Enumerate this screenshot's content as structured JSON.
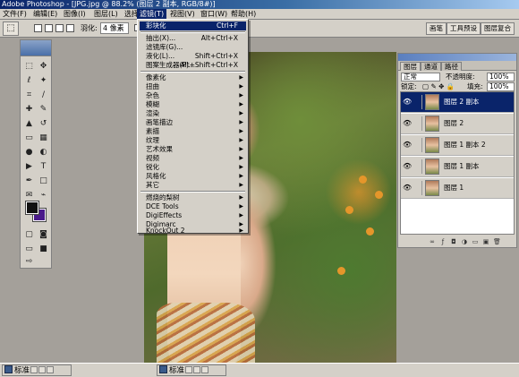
{
  "window": {
    "title": "Adobe Photoshop - [JPG.jpg @ 88.2% (图层 2 副本, RGB/8#)]"
  },
  "menubar": [
    {
      "label": "文件(F)"
    },
    {
      "label": "编辑(E)"
    },
    {
      "label": "图像(I)"
    },
    {
      "label": "图层(L)"
    },
    {
      "label": "选择(S)"
    },
    {
      "label": "滤镜(T)"
    },
    {
      "label": "视图(V)"
    },
    {
      "label": "窗口(W)"
    },
    {
      "label": "帮助(H)"
    }
  ],
  "options": {
    "feather_label": "羽化:",
    "feather_value": "4 像素",
    "antialias_label": "消除锯齿"
  },
  "palette_well": [
    "画笔",
    "工具预设",
    "图层复合"
  ],
  "filter_menu": {
    "items": [
      {
        "label": "彩块化",
        "shortcut": "Ctrl+F",
        "submenu": false,
        "highlighted": true
      },
      {
        "label": "抽出(X)...",
        "shortcut": "Alt+Ctrl+X",
        "submenu": false
      },
      {
        "label": "滤镜库(G)...",
        "shortcut": "",
        "submenu": false
      },
      {
        "label": "液化(L)...",
        "shortcut": "Shift+Ctrl+X",
        "submenu": false
      },
      {
        "label": "图案生成器(P)...",
        "shortcut": "Alt+Shift+Ctrl+X",
        "submenu": false
      },
      {
        "label": "像素化",
        "shortcut": "",
        "submenu": true
      },
      {
        "label": "扭曲",
        "shortcut": "",
        "submenu": true
      },
      {
        "label": "杂色",
        "shortcut": "",
        "submenu": true
      },
      {
        "label": "模糊",
        "shortcut": "",
        "submenu": true
      },
      {
        "label": "渲染",
        "shortcut": "",
        "submenu": true
      },
      {
        "label": "画笔描边",
        "shortcut": "",
        "submenu": true
      },
      {
        "label": "素描",
        "shortcut": "",
        "submenu": true
      },
      {
        "label": "纹理",
        "shortcut": "",
        "submenu": true
      },
      {
        "label": "艺术效果",
        "shortcut": "",
        "submenu": true
      },
      {
        "label": "视频",
        "shortcut": "",
        "submenu": true
      },
      {
        "label": "锐化",
        "shortcut": "",
        "submenu": true
      },
      {
        "label": "风格化",
        "shortcut": "",
        "submenu": true
      },
      {
        "label": "其它",
        "shortcut": "",
        "submenu": true
      },
      {
        "label": "燃烧的梨树",
        "shortcut": "",
        "submenu": true
      },
      {
        "label": "DCE Tools",
        "shortcut": "",
        "submenu": true
      },
      {
        "label": "DigiEffects",
        "shortcut": "",
        "submenu": true
      },
      {
        "label": "Digimarc",
        "shortcut": "",
        "submenu": true
      },
      {
        "label": "KnockOut 2",
        "shortcut": "",
        "submenu": true
      }
    ]
  },
  "layers_panel": {
    "tabs": [
      "图层",
      "通道",
      "路径"
    ],
    "blend_mode": "正常",
    "opacity_label": "不透明度:",
    "opacity_value": "100%",
    "lock_label": "锁定:",
    "fill_label": "填充:",
    "fill_value": "100%",
    "layers": [
      {
        "name": "图层 2 副本",
        "selected": true
      },
      {
        "name": "图层 2",
        "selected": false
      },
      {
        "name": "图层 1 副本 2",
        "selected": false
      },
      {
        "name": "图层 1 副本",
        "selected": false
      },
      {
        "name": "图层 1",
        "selected": false
      }
    ]
  },
  "status": {
    "left_label": "标准",
    "center_label": "标准"
  },
  "colors": {
    "foreground": "#111111",
    "background": "#4a1a8a",
    "highlight": "#0a246a"
  }
}
